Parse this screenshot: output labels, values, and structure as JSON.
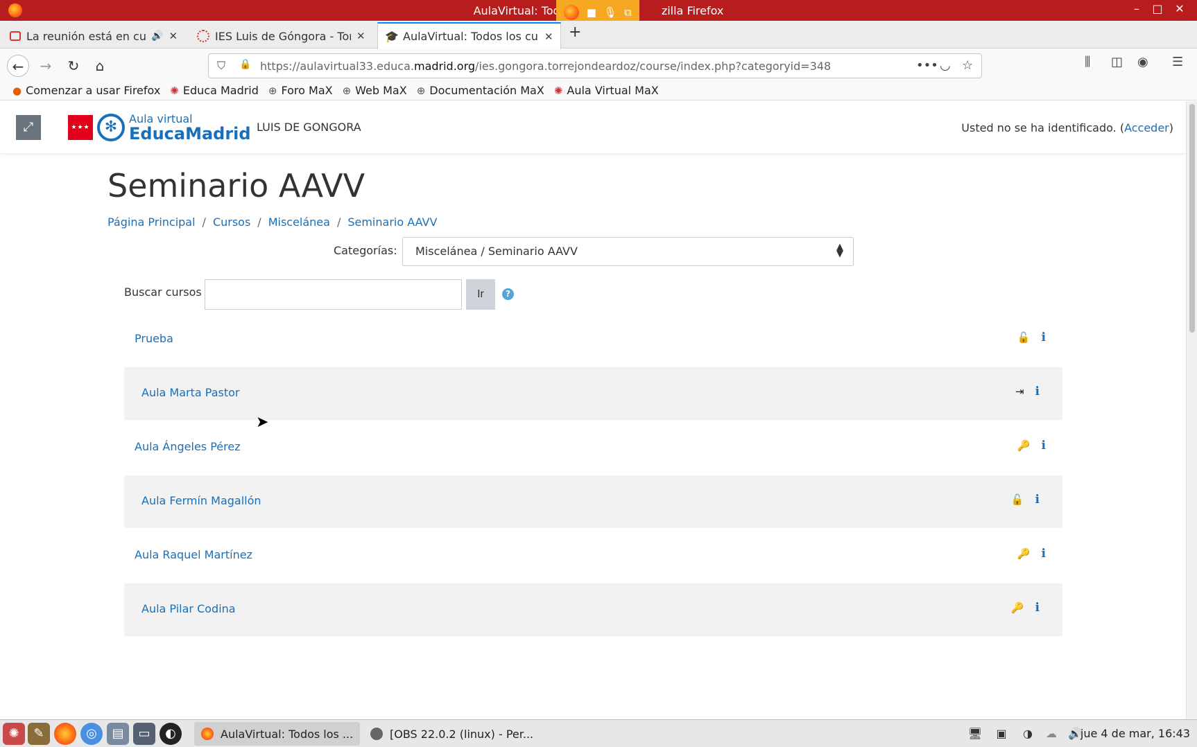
{
  "window": {
    "title": "AulaVirtual: Todos",
    "title_suffix": "zilla Firefox",
    "minimize": "–",
    "maximize": "□",
    "close": "✕"
  },
  "tabs": [
    {
      "label": "La reunión está en curso",
      "has_audio": true,
      "close": "✕"
    },
    {
      "label": "IES Luis de Góngora - Torrejón",
      "close": "✕"
    },
    {
      "label": "AulaVirtual: Todos los cursos",
      "close": "✕",
      "active": true
    }
  ],
  "new_tab_label": "+",
  "nav": {
    "url_prefix": "https://aulavirtual33.educa.",
    "url_domain": "madrid.org",
    "url_path": "/ies.gongora.torrejondeardoz/course/index.php?categoryid=348",
    "more": "•••"
  },
  "bookmarks": [
    {
      "label": "Comenzar a usar Firefox",
      "icon": "firefox-icon"
    },
    {
      "label": "Educa Madrid",
      "icon": "educamadrid-icon"
    },
    {
      "label": "Foro MaX",
      "icon": "globe-icon"
    },
    {
      "label": "Web MaX",
      "icon": "globe-icon"
    },
    {
      "label": "Documentación MaX",
      "icon": "globe-icon"
    },
    {
      "label": "Aula Virtual MaX",
      "icon": "educamadrid-icon"
    }
  ],
  "header": {
    "logo_small": "Aula virtual",
    "logo_big": "EducaMadrid",
    "site_name": "LUIS DE GONGORA",
    "login_text": "Usted no se ha identificado. (",
    "login_link": "Acceder",
    "login_close": ")"
  },
  "page": {
    "title": "Seminario AAVV",
    "breadcrumb": [
      "Página Principal",
      "Cursos",
      "Miscelánea",
      "Seminario AAVV"
    ],
    "category_label": "Categorías:",
    "category_value": "Miscelánea / Seminario AAVV",
    "search_label": "Buscar cursos",
    "search_value": "",
    "search_button": "Ir",
    "help": "?"
  },
  "courses": [
    {
      "name": "Prueba",
      "access": "unlock-icon",
      "access_glyph": "🔓",
      "info": "i"
    },
    {
      "name": "Aula Marta Pastor",
      "access": "sign-in-icon",
      "access_glyph": "⇥",
      "info": "i"
    },
    {
      "name": "Aula Ángeles Pérez",
      "access": "key-icon",
      "access_glyph": "🔑",
      "info": "i"
    },
    {
      "name": "Aula Fermín Magallón",
      "access": "unlock-icon",
      "access_glyph": "🔓",
      "info": "i"
    },
    {
      "name": "Aula Raquel Martínez",
      "access": "key-icon",
      "access_glyph": "🔑",
      "info": "i"
    },
    {
      "name": "Aula Pilar Codina",
      "access": "key-icon",
      "access_glyph": "🔑",
      "info": "i"
    }
  ],
  "taskbar": {
    "windows": [
      {
        "label": "AulaVirtual: Todos los ..."
      },
      {
        "label": "[OBS 22.0.2 (linux) - Per..."
      }
    ],
    "clock": "jue  4 de mar, 16:43"
  },
  "colors": {
    "accent": "#1a6fb8",
    "titlebar": "#b81d1d",
    "shaded_row": "#f2f2f2"
  }
}
